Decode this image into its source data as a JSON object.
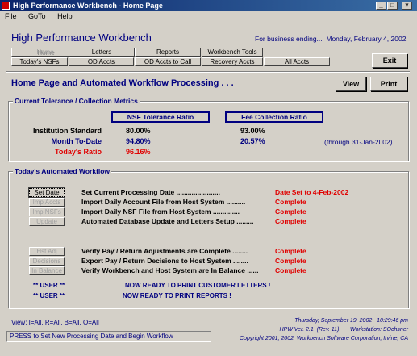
{
  "window": {
    "title": "High Performance Workbench - Home Page",
    "minimize": "_",
    "maximize": "□",
    "close": "×"
  },
  "menu": [
    "File",
    "GoTo",
    "Help"
  ],
  "header": {
    "title": "High Performance Workbench",
    "business_label": "For business ending...",
    "business_date": "Monday, February 4, 2002"
  },
  "nav": {
    "row1": [
      "Home",
      "Letters",
      "Reports",
      "Workbench Tools"
    ],
    "row2": [
      "Today's NSFs",
      "OD Accts",
      "OD Accts to Call",
      "Recovery Accts",
      "All Accts"
    ],
    "exit": "Exit"
  },
  "section": {
    "title": "Home Page and Automated Workflow Processing . . .",
    "view": "View",
    "print": "Print"
  },
  "metrics": {
    "group_label": "Current Tolerance / Collection Metrics",
    "col1": "NSF Tolerance Ratio",
    "col2": "Fee Collection Ratio",
    "rows": [
      {
        "label": "Institution Standard",
        "nsf": "80.00%",
        "fee": "93.00%",
        "note": ""
      },
      {
        "label": "Month To-Date",
        "nsf": "94.80%",
        "fee": "20.57%",
        "note": "(through 31-Jan-2002)"
      },
      {
        "label": "Today's Ratio",
        "nsf": "96.16%",
        "fee": "",
        "note": ""
      }
    ],
    "colors": {
      "standard": "#000000",
      "mtd": "#000080",
      "today": "#e00000"
    }
  },
  "workflow": {
    "group_label": "Today's Automated Workflow",
    "steps1": [
      {
        "button": "Set Date",
        "text": "Set Current Processing Date .......................",
        "status": "Date Set to 4-Feb-2002"
      },
      {
        "button": "Imp Accts",
        "text": "Import Daily Account File from Host System ..........",
        "status": "Complete"
      },
      {
        "button": "Imp NSFs",
        "text": "Import Daily NSF File from Host System ..............",
        "status": "Complete"
      },
      {
        "button": "Update",
        "text": "Automated Database Update and Letters Setup .........",
        "status": "Complete"
      }
    ],
    "steps2": [
      {
        "button": "Hst Adj",
        "text": "Verify Pay / Return Adjustments are Complete ........",
        "status": "Complete"
      },
      {
        "button": "Decisions",
        "text": "Export Pay / Return Decisions to Host System ........",
        "status": "Complete"
      },
      {
        "button": "In Balance",
        "text": "Verify Workbench and Host System are In Balance ......",
        "status": "Complete"
      }
    ],
    "user_lines": [
      {
        "user": "** USER **",
        "msg": "NOW READY TO PRINT CUSTOMER LETTERS !"
      },
      {
        "user": "** USER **",
        "msg": "NOW READY TO PRINT REPORTS !"
      }
    ]
  },
  "footer": {
    "view_legend": "View:  I=All, R=All, B=All, O=All",
    "status": "PRESS to Set New Processing Date and Begin Workflow",
    "datetime": "Thursday, September 19, 2002   10:29:46 pm",
    "version": "HPW Ver. 2.1  (Rev. 11)       Workstation: SOchsner",
    "copyright": "Copyright 2001, 2002  Workbench Software Corporation, Irvine, CA"
  }
}
